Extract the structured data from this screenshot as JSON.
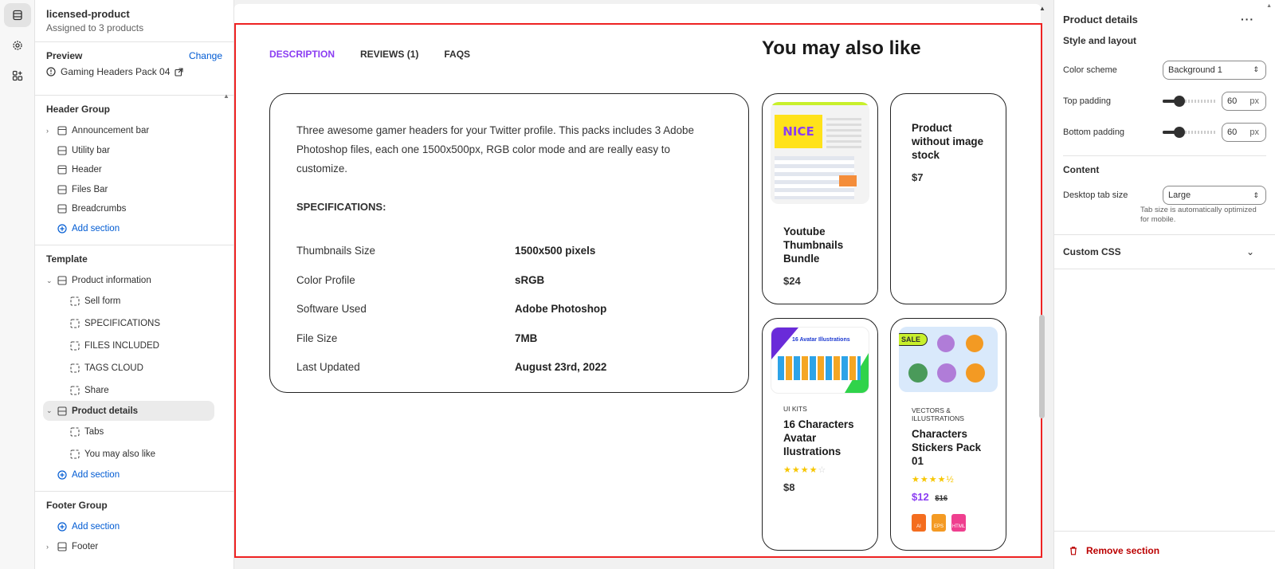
{
  "sidebar": {
    "title": "licensed-product",
    "subtitle": "Assigned to 3 products",
    "preview_label": "Preview",
    "change_label": "Change",
    "preview_product": "Gaming Headers Pack 04",
    "header_group": {
      "title": "Header Group",
      "items": [
        "Announcement bar",
        "Utility bar",
        "Header",
        "Files Bar",
        "Breadcrumbs"
      ],
      "add_label": "Add section"
    },
    "template": {
      "title": "Template",
      "product_information": "Product information",
      "pi_blocks": [
        "Sell form",
        "SPECIFICATIONS",
        "FILES INCLUDED",
        "TAGS CLOUD",
        "Share"
      ],
      "product_details": "Product details",
      "pd_blocks": [
        "Tabs",
        "You may also like"
      ],
      "add_label": "Add section"
    },
    "footer_group": {
      "title": "Footer Group",
      "add_label": "Add section",
      "footer": "Footer"
    }
  },
  "preview": {
    "tabs": [
      "DESCRIPTION",
      "REVIEWS (1)",
      "FAQS"
    ],
    "description": "Three awesome gamer headers for your Twitter profile. This packs includes 3 Adobe Photoshop files, each one 1500x500px, RGB color mode and are really easy to customize.",
    "specs_heading": "SPECIFICATIONS:",
    "specs": [
      {
        "k": "Thumbnails Size",
        "v": "1500x500 pixels"
      },
      {
        "k": "Color Profile",
        "v": "sRGB"
      },
      {
        "k": "Software Used",
        "v": "Adobe Photoshop"
      },
      {
        "k": "File Size",
        "v": "7MB"
      },
      {
        "k": "Last Updated",
        "v": "August 23rd, 2022"
      }
    ],
    "ymal_title": "You may also like",
    "cards": {
      "c1": {
        "title": "Youtube Thumbnails Bundle",
        "price": "$24",
        "thumb_text": "NICE"
      },
      "c2": {
        "title": "Product without image stock",
        "price": "$7"
      },
      "c3": {
        "category": "UI KITS",
        "title": "16 Characters Avatar Ilustrations",
        "price": "$8",
        "rating": 4,
        "thumb_text": "16 Avatar Illustrations"
      },
      "c4": {
        "category": "VECTORS & ILLUSTRATIONS",
        "title": "Characters Stickers Pack 01",
        "price": "$12",
        "old_price": "$16",
        "rating": 4.5,
        "badge": "SALE",
        "file_tags": [
          "AI",
          "EPS",
          "HTML"
        ]
      }
    }
  },
  "settings": {
    "title": "Product details",
    "style_heading": "Style and layout",
    "color_scheme_label": "Color scheme",
    "color_scheme_value": "Background 1",
    "top_padding_label": "Top padding",
    "top_padding_value": "60",
    "bottom_padding_label": "Bottom padding",
    "bottom_padding_value": "60",
    "unit": "px",
    "content_heading": "Content",
    "tab_size_label": "Desktop tab size",
    "tab_size_value": "Large",
    "tab_size_hint": "Tab size is automatically optimized for mobile.",
    "custom_css": "Custom CSS",
    "remove_label": "Remove section"
  },
  "colors": {
    "accent": "#8b3df2",
    "link": "#005bd3",
    "highlight": "#e22222",
    "danger": "#b00000",
    "price_sale": "#8b3df2"
  }
}
